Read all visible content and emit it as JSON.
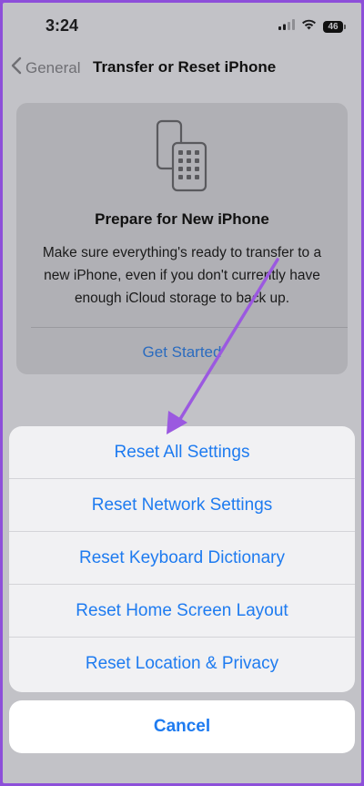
{
  "status": {
    "time": "3:24",
    "battery": "46"
  },
  "nav": {
    "back_label": "General",
    "title": "Transfer or Reset iPhone"
  },
  "card": {
    "icon": "transfer-phones-icon",
    "title": "Prepare for New iPhone",
    "description": "Make sure everything's ready to transfer to a new iPhone, even if you don't currently have enough iCloud storage to back up.",
    "link": "Get Started"
  },
  "sheet": {
    "items": [
      {
        "label": "Reset All Settings"
      },
      {
        "label": "Reset Network Settings"
      },
      {
        "label": "Reset Keyboard Dictionary"
      },
      {
        "label": "Reset Home Screen Layout"
      },
      {
        "label": "Reset Location & Privacy"
      }
    ],
    "cancel": "Cancel"
  },
  "colors": {
    "accent": "#1e7bf0",
    "annotation": "#9b59e0",
    "frame": "#8d4fd9"
  }
}
